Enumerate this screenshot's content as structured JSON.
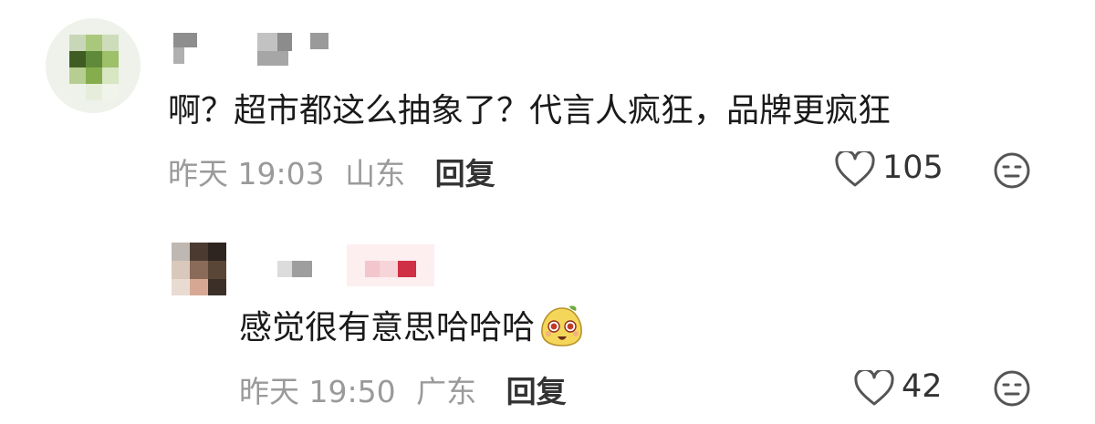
{
  "comments": [
    {
      "text": "啊？超市都这么抽象了？代言人疯狂，品牌更疯狂",
      "time": "昨天 19:03",
      "location": "山东",
      "reply_label": "回复",
      "likes": "105",
      "icons": [
        "heart-icon",
        "emoji-face-icon"
      ]
    },
    {
      "text": "感觉很有意思哈哈哈",
      "emoji": "pear-mascot-sticker",
      "time": "昨天 19:50",
      "location": "广东",
      "reply_label": "回复",
      "likes": "42",
      "icons": [
        "heart-icon",
        "emoji-face-icon"
      ]
    }
  ],
  "colors": {
    "text": "#1a1a1a",
    "meta": "#9a9a9a",
    "reply": "#333333",
    "icon": "#555555"
  }
}
